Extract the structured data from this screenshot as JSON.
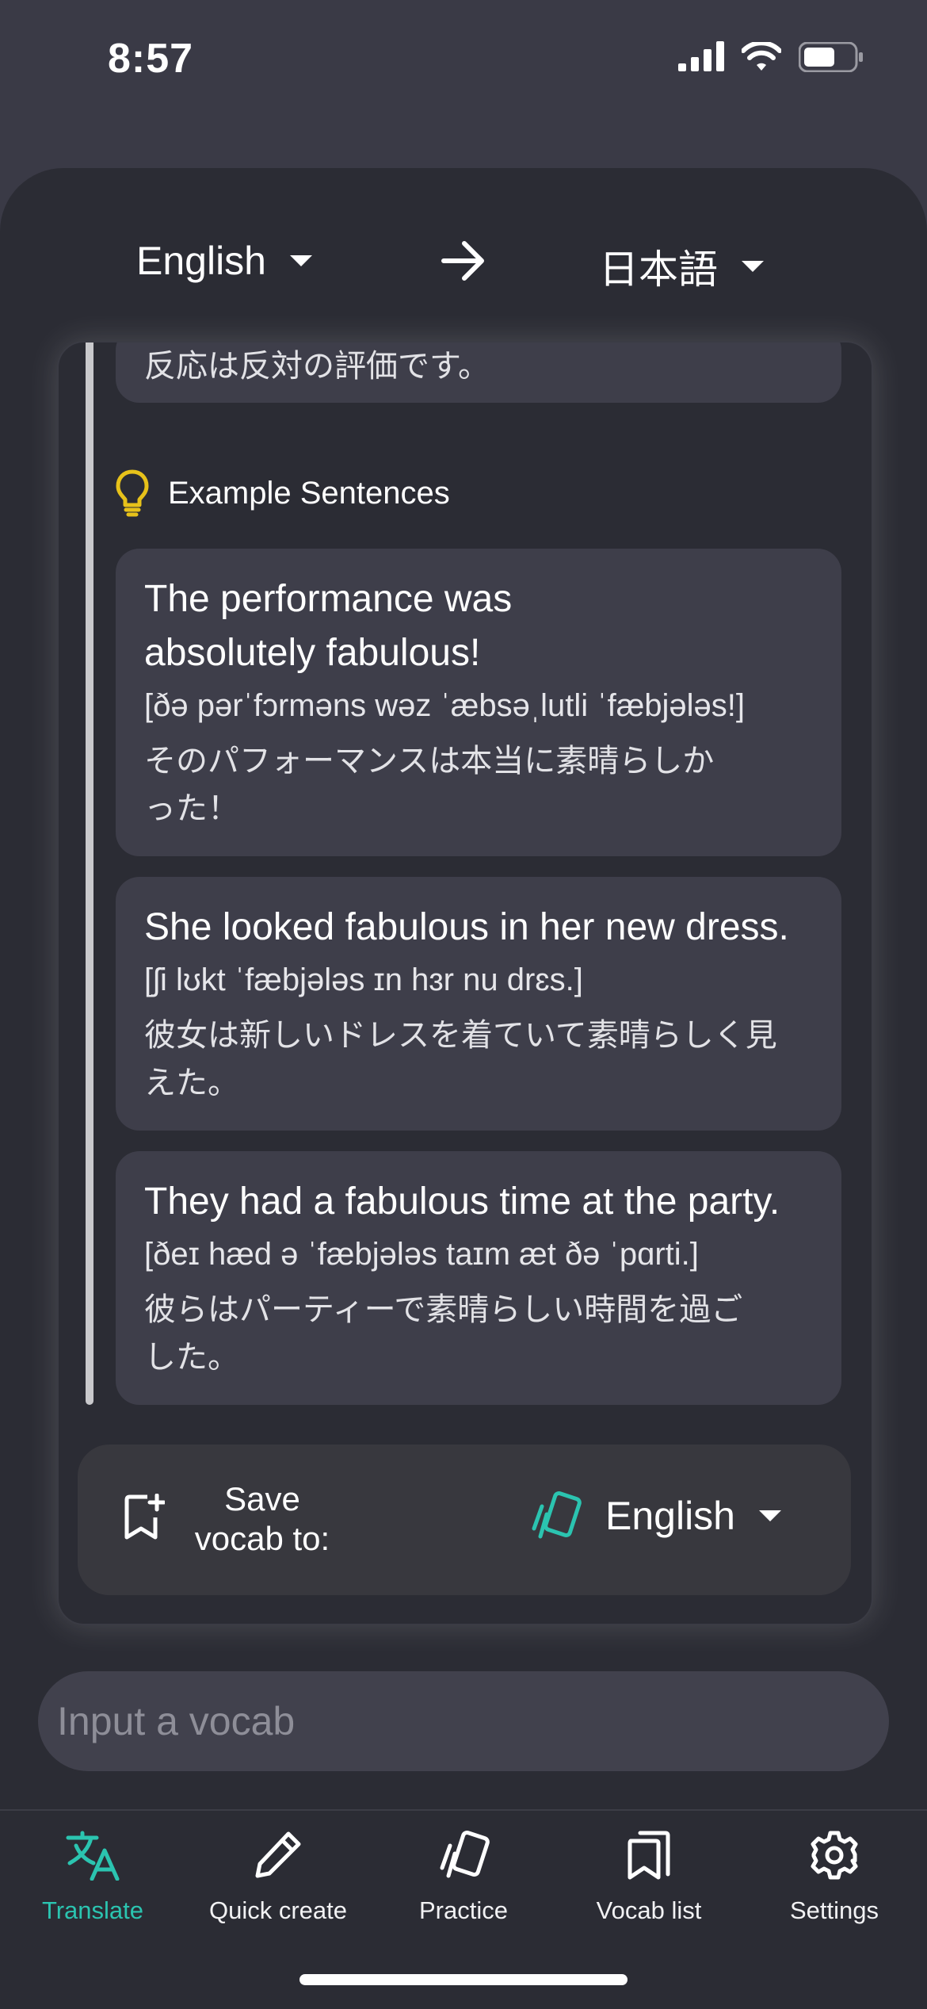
{
  "status": {
    "time": "8:57"
  },
  "languages": {
    "source": "English",
    "target": "日本語"
  },
  "previous_entry": {
    "japanese": "反応は反対の評価です。"
  },
  "examples": {
    "heading": "Example Sentences",
    "items": [
      {
        "english": "The performance was absolutely fabulous!",
        "ipa": "[ðə pərˈfɔrməns wəz ˈæbsəˌlutli ˈfæbjələs!]",
        "japanese": "そのパフォーマンスは本当に素晴らしかった！"
      },
      {
        "english": "She looked fabulous in her new dress.",
        "ipa": "[ʃi lʊkt ˈfæbjələs ɪn hɜr nu drɛs.]",
        "japanese": "彼女は新しいドレスを着ていて素晴らしく見えた。"
      },
      {
        "english": "They had a fabulous time at the party.",
        "ipa": "[ðeɪ hæd ə ˈfæbjələs taɪm æt ðə ˈpɑrti.]",
        "japanese": "彼らはパーティーで素晴らしい時間を過ごした。"
      }
    ]
  },
  "save": {
    "label": "Save vocab to:",
    "deck": "English"
  },
  "input": {
    "placeholder": "Input a vocab"
  },
  "tabs": [
    {
      "label": "Translate",
      "icon": "translate-icon",
      "active": true
    },
    {
      "label": "Quick create",
      "icon": "pencil-icon",
      "active": false
    },
    {
      "label": "Practice",
      "icon": "cards-icon",
      "active": false
    },
    {
      "label": "Vocab list",
      "icon": "bookmarks-icon",
      "active": false
    },
    {
      "label": "Settings",
      "icon": "gear-icon",
      "active": false
    }
  ],
  "colors": {
    "accent": "#2bc4b0",
    "bulb": "#e7c21a",
    "background": "#2b2c34"
  }
}
